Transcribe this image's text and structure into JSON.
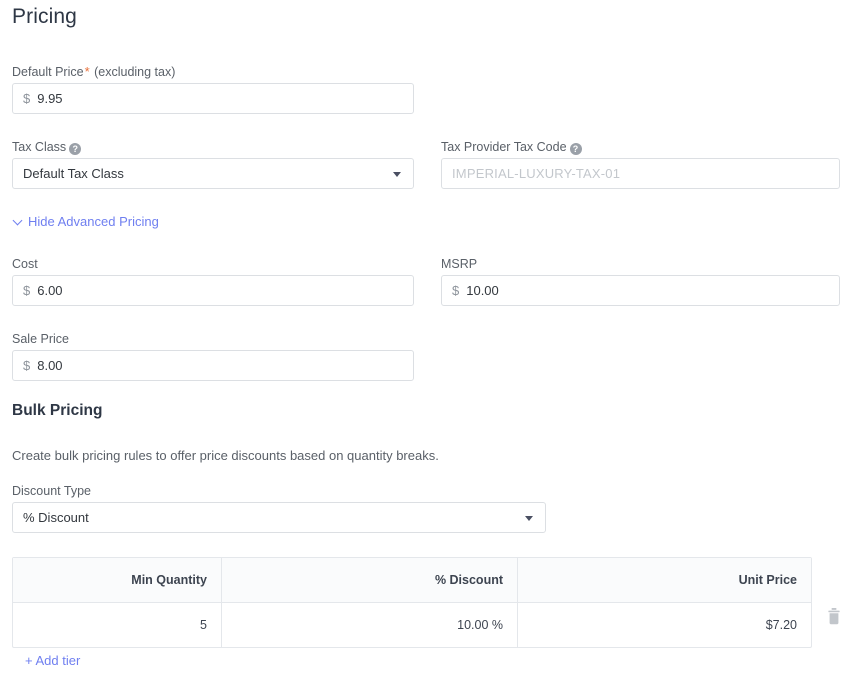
{
  "page": {
    "title": "Pricing"
  },
  "fields": {
    "default_price": {
      "label": "Default Price",
      "required_mark": "*",
      "label_suffix": "(excluding tax)",
      "currency": "$",
      "value": "9.95"
    },
    "tax_class": {
      "label": "Tax Class",
      "help_icon": "help-circle-icon",
      "value": "Default Tax Class",
      "options": [
        "Default Tax Class"
      ]
    },
    "tax_provider_tax_code": {
      "label": "Tax Provider Tax Code",
      "help_icon": "help-circle-icon",
      "value": "",
      "placeholder": "IMPERIAL-LUXURY-TAX-01"
    },
    "cost": {
      "label": "Cost",
      "currency": "$",
      "value": "6.00"
    },
    "msrp": {
      "label": "MSRP",
      "currency": "$",
      "value": "10.00"
    },
    "sale_price": {
      "label": "Sale Price",
      "currency": "$",
      "value": "8.00"
    }
  },
  "advanced_pricing_toggle": {
    "label": "Hide Advanced Pricing",
    "icon": "chevron-down-icon"
  },
  "bulk_pricing": {
    "title": "Bulk Pricing",
    "description": "Create bulk pricing rules to offer price discounts based on quantity breaks.",
    "discount_type": {
      "label": "Discount Type",
      "value": "% Discount",
      "options": [
        "% Discount"
      ]
    },
    "table": {
      "columns": [
        "Min Quantity",
        "% Discount",
        "Unit Price"
      ],
      "rows": [
        {
          "min_quantity": "5",
          "discount": "10.00 %",
          "unit_price": "$7.20",
          "delete_icon": "trash-icon"
        }
      ]
    },
    "add_tier_label": "+ Add tier"
  },
  "colors": {
    "link": "#6f7ff0",
    "required": "#e8703a",
    "heading": "#2e3745",
    "label": "#5a6068",
    "border": "#dcdfe3",
    "table_header_bg": "#fafbfc"
  }
}
